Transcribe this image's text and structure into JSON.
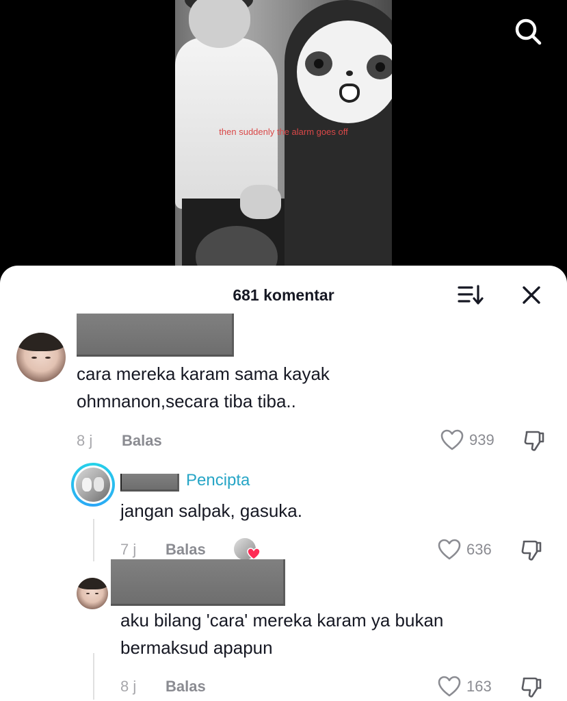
{
  "video": {
    "caption": "then suddenly the alarm goes off"
  },
  "sheet": {
    "title": "681 komentar"
  },
  "comments": [
    {
      "text_lines": [
        "cara mereka karam sama kayak",
        "ohmnanon,secara tiba tiba.."
      ],
      "time": "8 j",
      "reply_label": "Balas",
      "likes": "939"
    }
  ],
  "replies": [
    {
      "creator_tag": "Pencipta",
      "text_lines": [
        "jangan salpak, gasuka."
      ],
      "time": "7 j",
      "reply_label": "Balas",
      "likes": "636",
      "liked_by_creator": true
    },
    {
      "text_lines": [
        "aku bilang 'cara' mereka karam ya bukan",
        "bermaksud apapun"
      ],
      "time": "8 j",
      "reply_label": "Balas",
      "likes": "163"
    }
  ],
  "colors": {
    "creator_tag": "#26a5c6",
    "muted": "#8a8b91",
    "heart_badge": "#fe2c55",
    "caption": "#d94848"
  },
  "icons": {
    "search": "search-icon",
    "sort": "sort-icon",
    "close": "close-icon",
    "like": "heart-outline-icon",
    "dislike": "thumbs-down-icon"
  }
}
